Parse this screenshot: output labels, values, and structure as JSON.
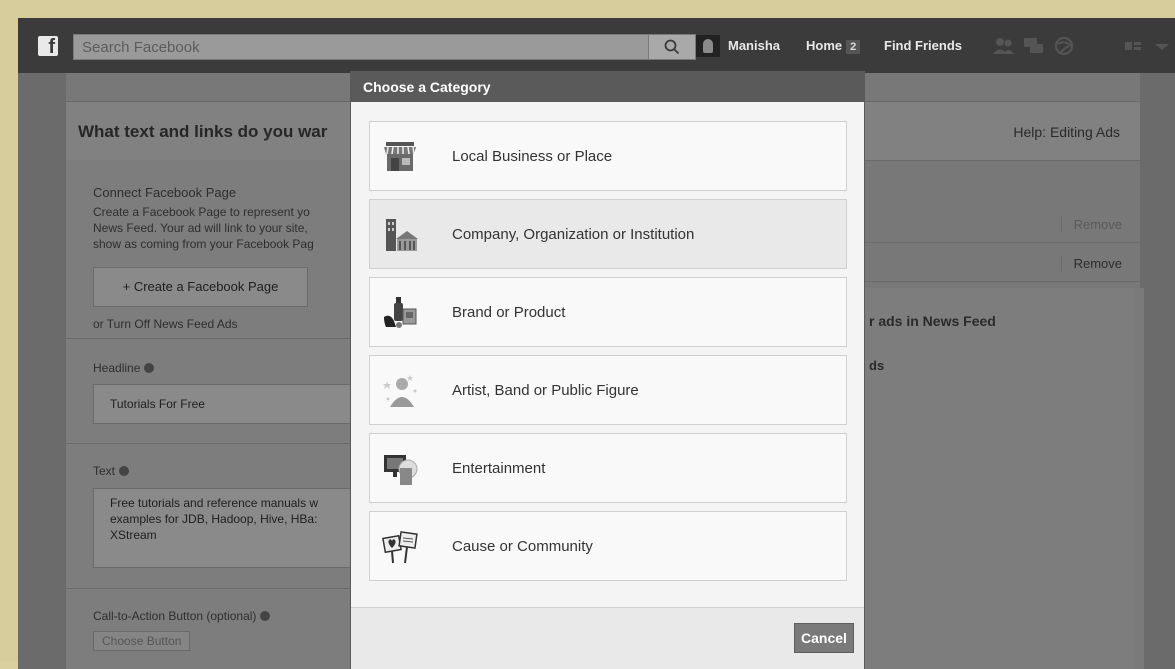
{
  "topbar": {
    "search_placeholder": "Search Facebook",
    "user_name": "Manisha",
    "home_label": "Home",
    "home_badge": "2",
    "find_friends_label": "Find Friends"
  },
  "page": {
    "title": "What text and links do you war",
    "help_link": "Help: Editing Ads",
    "connect_label": "Connect Facebook Page",
    "connect_text": "Create a Facebook Page to represent yo\nNews Feed. Your ad will link to your site,\nshow as coming from your Facebook Pag",
    "create_page_button": "+ Create a Facebook Page",
    "turn_off_link": "or Turn Off News Feed Ads",
    "headline_label": "Headline",
    "headline_value": "Tutorials For Free",
    "text_label": "Text",
    "text_value": "Free tutorials and reference manuals w\nexamples for JDB, Hadoop, Hive, HBa:\nXStream",
    "cta_label": "Call-to-Action Button (optional)",
    "cta_select": "Choose Button",
    "remove_1": "Remove",
    "remove_2": "Remove",
    "preview_title": "r ads in News Feed",
    "preview_sub": "ds"
  },
  "modal": {
    "title": "Choose a Category",
    "categories": [
      {
        "label": "Local Business or Place",
        "icon": "storefront-icon"
      },
      {
        "label": "Company, Organization or Institution",
        "icon": "buildings-icon"
      },
      {
        "label": "Brand or Product",
        "icon": "products-icon"
      },
      {
        "label": "Artist, Band or Public Figure",
        "icon": "person-star-icon"
      },
      {
        "label": "Entertainment",
        "icon": "tv-icon"
      },
      {
        "label": "Cause or Community",
        "icon": "signs-icon"
      }
    ],
    "cancel_label": "Cancel"
  }
}
